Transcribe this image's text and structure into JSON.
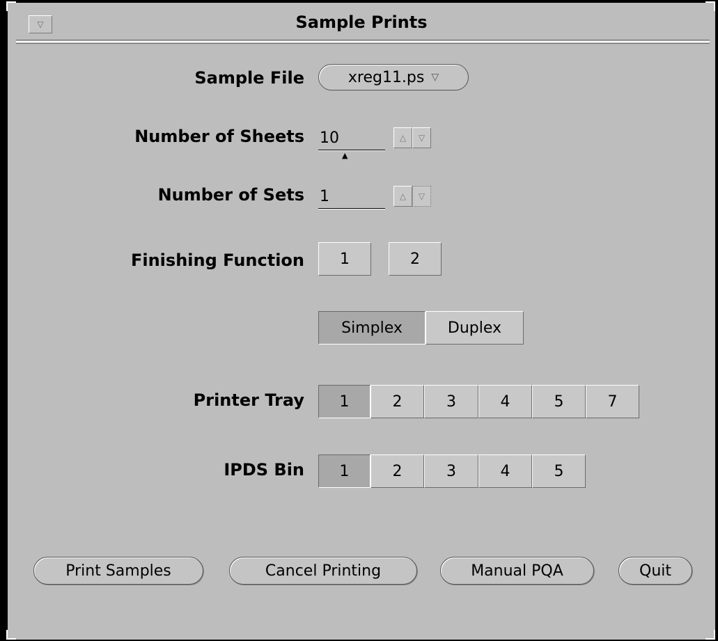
{
  "window": {
    "title": "Sample Prints",
    "menu_icon": "triangle-down-icon"
  },
  "sample_file": {
    "label": "Sample File",
    "value": "xreg11.ps",
    "arrow": "▽"
  },
  "num_sheets": {
    "label": "Number of Sheets",
    "value": "10",
    "caret": "▲",
    "up": "△",
    "down": "▽"
  },
  "num_sets": {
    "label": "Number of Sets",
    "value": "1",
    "up": "△",
    "down": "▽"
  },
  "finishing": {
    "label": "Finishing Function",
    "options": [
      "1",
      "2"
    ]
  },
  "sides": {
    "options": [
      "Simplex",
      "Duplex"
    ],
    "selected": "Simplex"
  },
  "printer_tray": {
    "label": "Printer Tray",
    "options": [
      "1",
      "2",
      "3",
      "4",
      "5",
      "7"
    ],
    "selected": "1"
  },
  "ipds_bin": {
    "label": "IPDS Bin",
    "options": [
      "1",
      "2",
      "3",
      "4",
      "5"
    ],
    "selected": "1"
  },
  "actions": {
    "print_samples": "Print Samples",
    "cancel_printing": "Cancel Printing",
    "manual_pqa": "Manual PQA",
    "quit": "Quit"
  }
}
